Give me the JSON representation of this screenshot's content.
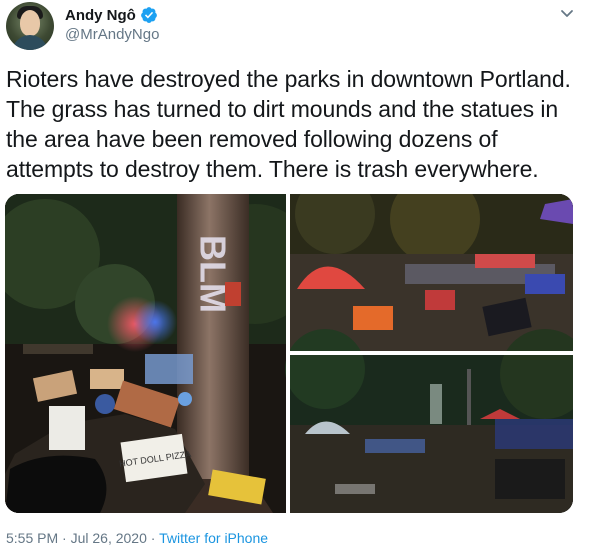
{
  "tweet": {
    "author_name": "Andy Ngô",
    "author_handle": "@MrAndyNgo",
    "body": "Rioters have destroyed the parks in downtown Portland. The grass has turned to dirt mounds and the statues in the area have been removed following dozens of attempts to destroy them. There is trash everywhere.",
    "time": "5:55 PM",
    "separator": " · ",
    "date": "Jul 26, 2020",
    "source": "Twitter for iPhone"
  },
  "media": {
    "tree_graffiti": "BLM",
    "pizza_box_text": "HOT DOLL PIZZA"
  },
  "colors": {
    "text": "#14171a",
    "secondary": "#657786",
    "link": "#1b95e0",
    "verified": "#1da1f2"
  },
  "icons": {
    "verified": "verified-badge-icon",
    "more": "chevron-down-icon"
  }
}
